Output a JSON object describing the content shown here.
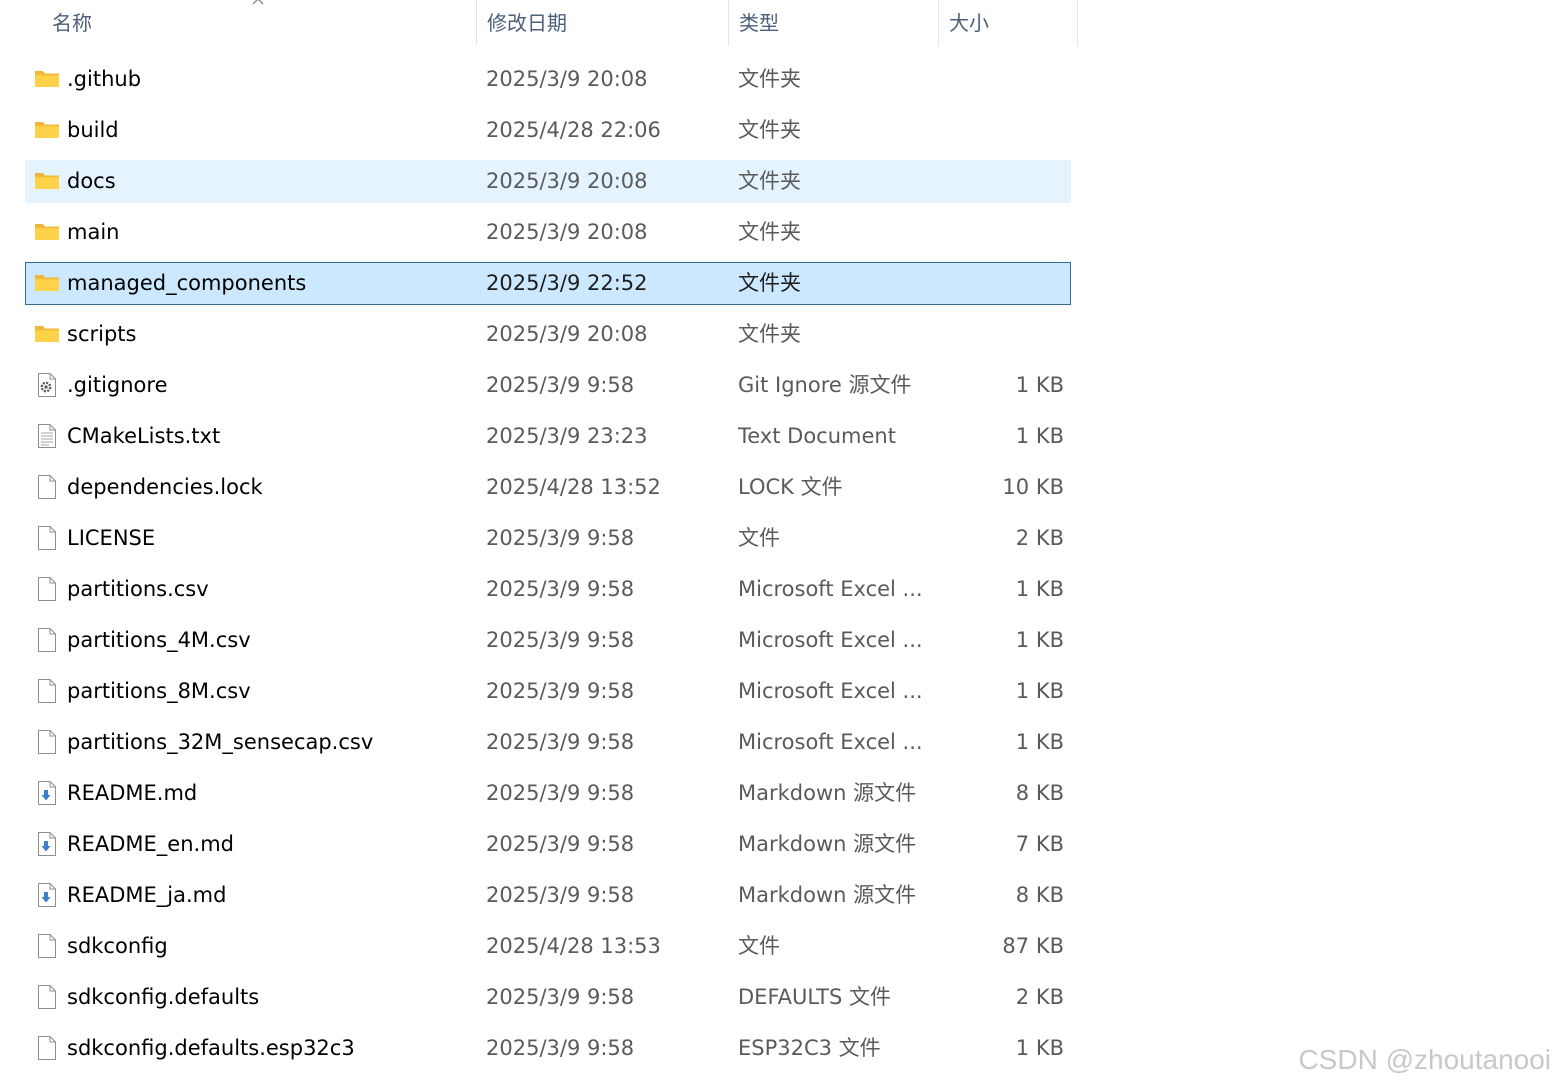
{
  "header": {
    "name_label": "名称",
    "date_label": "修改日期",
    "type_label": "类型",
    "size_label": "大小"
  },
  "rows": [
    {
      "name": ".github",
      "date": "2025/3/9 20:08",
      "type": "文件夹",
      "size": "",
      "icon": "folder-icon"
    },
    {
      "name": "build",
      "date": "2025/4/28 22:06",
      "type": "文件夹",
      "size": "",
      "icon": "folder-icon"
    },
    {
      "name": "docs",
      "date": "2025/3/9 20:08",
      "type": "文件夹",
      "size": "",
      "icon": "folder-icon",
      "state": "hover"
    },
    {
      "name": "main",
      "date": "2025/3/9 20:08",
      "type": "文件夹",
      "size": "",
      "icon": "folder-icon"
    },
    {
      "name": "managed_components",
      "date": "2025/3/9 22:52",
      "type": "文件夹",
      "size": "",
      "icon": "folder-icon",
      "state": "selected"
    },
    {
      "name": "scripts",
      "date": "2025/3/9 20:08",
      "type": "文件夹",
      "size": "",
      "icon": "folder-icon"
    },
    {
      "name": ".gitignore",
      "date": "2025/3/9 9:58",
      "type": "Git Ignore 源文件",
      "size": "1 KB",
      "icon": "settings-file-icon"
    },
    {
      "name": "CMakeLists.txt",
      "date": "2025/3/9 23:23",
      "type": "Text Document",
      "size": "1 KB",
      "icon": "text-file-icon"
    },
    {
      "name": "dependencies.lock",
      "date": "2025/4/28 13:52",
      "type": "LOCK 文件",
      "size": "10 KB",
      "icon": "file-icon"
    },
    {
      "name": "LICENSE",
      "date": "2025/3/9 9:58",
      "type": "文件",
      "size": "2 KB",
      "icon": "file-icon"
    },
    {
      "name": "partitions.csv",
      "date": "2025/3/9 9:58",
      "type": "Microsoft Excel ...",
      "size": "1 KB",
      "icon": "file-icon"
    },
    {
      "name": "partitions_4M.csv",
      "date": "2025/3/9 9:58",
      "type": "Microsoft Excel ...",
      "size": "1 KB",
      "icon": "file-icon"
    },
    {
      "name": "partitions_8M.csv",
      "date": "2025/3/9 9:58",
      "type": "Microsoft Excel ...",
      "size": "1 KB",
      "icon": "file-icon"
    },
    {
      "name": "partitions_32M_sensecap.csv",
      "date": "2025/3/9 9:58",
      "type": "Microsoft Excel ...",
      "size": "1 KB",
      "icon": "file-icon"
    },
    {
      "name": "README.md",
      "date": "2025/3/9 9:58",
      "type": "Markdown 源文件",
      "size": "8 KB",
      "icon": "markdown-file-icon"
    },
    {
      "name": "README_en.md",
      "date": "2025/3/9 9:58",
      "type": "Markdown 源文件",
      "size": "7 KB",
      "icon": "markdown-file-icon"
    },
    {
      "name": "README_ja.md",
      "date": "2025/3/9 9:58",
      "type": "Markdown 源文件",
      "size": "8 KB",
      "icon": "markdown-file-icon"
    },
    {
      "name": "sdkconfig",
      "date": "2025/4/28 13:53",
      "type": "文件",
      "size": "87 KB",
      "icon": "file-icon"
    },
    {
      "name": "sdkconfig.defaults",
      "date": "2025/3/9 9:58",
      "type": "DEFAULTS 文件",
      "size": "2 KB",
      "icon": "file-icon"
    },
    {
      "name": "sdkconfig.defaults.esp32c3",
      "date": "2025/3/9 9:58",
      "type": "ESP32C3 文件",
      "size": "1 KB",
      "icon": "file-icon"
    }
  ],
  "watermark": "CSDN @zhoutanooi",
  "colors": {
    "hover_bg": "#e5f3ff",
    "selected_bg": "#cce8ff",
    "selected_border": "#3c6a8c",
    "folder_yellow": "#ffd24a",
    "header_text": "#4c607a"
  }
}
